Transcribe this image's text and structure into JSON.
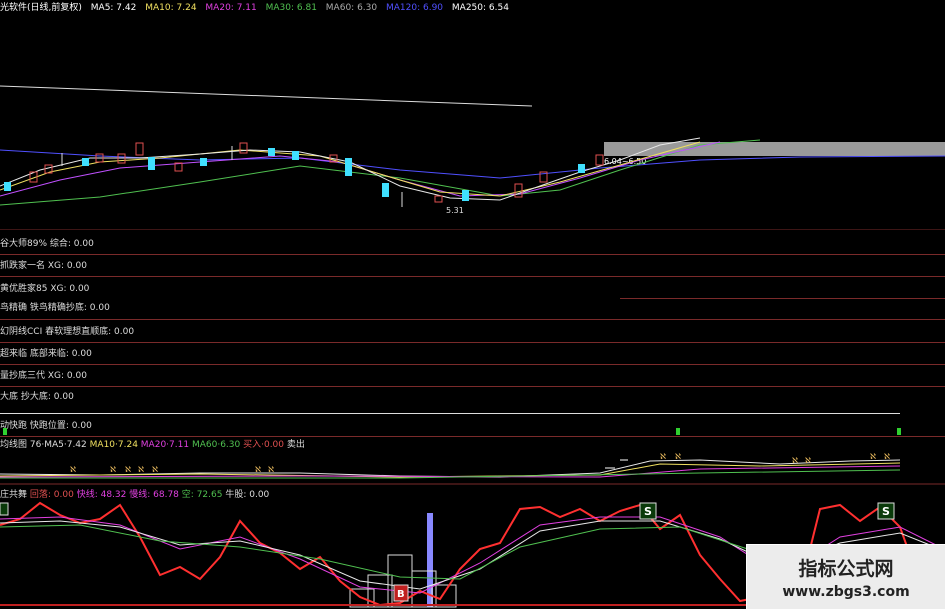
{
  "header": {
    "title": "光软件(日线,前复权)",
    "ma5": "MA5: 7.42",
    "ma10": "MA10: 7.24",
    "ma20": "MA20: 7.11",
    "ma30": "MA30: 6.81",
    "ma60": "MA60: 6.30",
    "ma120": "MA120: 6.90",
    "ma250": "MA250: 6.54"
  },
  "price_chart": {
    "low_label": "5.31",
    "box_label": "6.04~6.50"
  },
  "indicator_rows": [
    {
      "name": "谷大师89%",
      "value_label": "综合: 0.00"
    },
    {
      "name": "抓跌家一名",
      "value_label": "XG: 0.00"
    },
    {
      "name": "黄优胜家85",
      "value_label": "XG: 0.00"
    },
    {
      "name": "鸟精确",
      "value_label": "铁鸟精确抄底: 0.00"
    },
    {
      "name": "幻阴线CCI",
      "value_label": "春软理想直顺底: 0.00"
    },
    {
      "name": "超来临",
      "value_label": "底部来临: 0.00"
    },
    {
      "name": "量抄底三代",
      "value_label": "XG: 0.00"
    },
    {
      "name": "大底",
      "value_label": "抄大底: 0.00"
    },
    {
      "name": "动快跑",
      "value_label": "快跑位置: 0.00"
    }
  ],
  "ma_panel": {
    "label": "均线图",
    "ma5": "76·MA5·7.42",
    "ma10": "MA10·7.24",
    "ma20": "MA20·7.11",
    "ma60": "MA60·6.30",
    "buy": "买入·0.00",
    "sell": "卖出"
  },
  "kdj_panel": {
    "label": "庄共舞",
    "v1": "回落: 0.00",
    "v2": "快线: 48.32",
    "v3": "慢线: 68.78",
    "v4": "空: 72.65",
    "v5": "牛股: 0.00"
  },
  "watermark": {
    "title": "指标公式网",
    "url": "www.zbgs3.com"
  },
  "colors": {
    "up": "#e05050",
    "down": "#40e0ff",
    "ma_white": "#e8e8e8",
    "ma_yellow": "#f0e060",
    "ma_purple": "#c050ff",
    "ma_green": "#50c050",
    "ma_blue": "#5050ff",
    "row_line": "#7a2a2a"
  }
}
